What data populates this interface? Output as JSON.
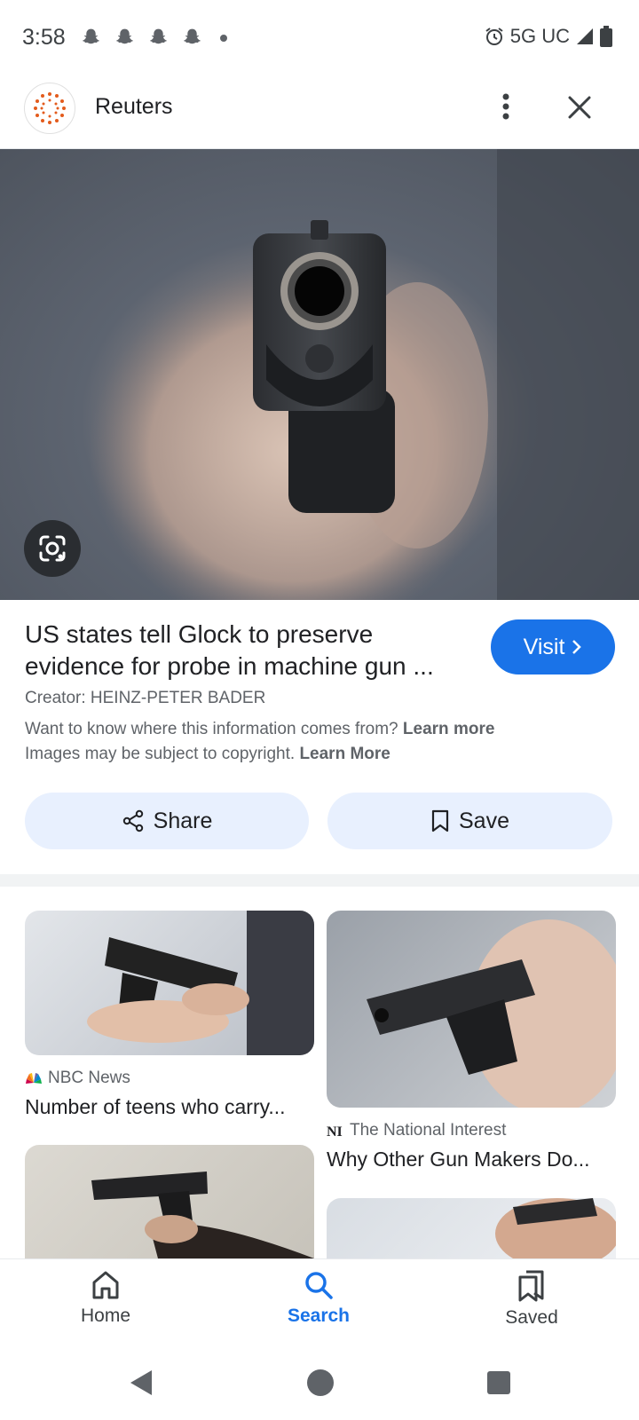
{
  "status_bar": {
    "time": "3:58",
    "notification_icons": [
      "snapchat-icon",
      "snapchat-icon",
      "snapchat-icon",
      "snapchat-icon",
      "more-dot"
    ],
    "network": "5G UC",
    "icons": [
      "alarm-icon",
      "signal-icon",
      "battery-icon"
    ]
  },
  "header": {
    "source_name": "Reuters",
    "more_icon": "more-vert-icon",
    "close_icon": "close-icon"
  },
  "image_detail": {
    "title": "US states tell Glock to preserve evidence for probe in machine gun ...",
    "visit_label": "Visit",
    "creator": "Creator: HEINZ-PETER BADER",
    "info_text": "Want to know where this information comes from?",
    "info_link": "Learn more",
    "copyright_text": "Images may be subject to copyright.",
    "copyright_link": "Learn More",
    "share_label": "Share",
    "save_label": "Save"
  },
  "related_results": [
    {
      "source": "NBC News",
      "title": "Number of teens who carry..."
    },
    {
      "source": "The National Interest",
      "title": "Why Other Gun Makers Do..."
    }
  ],
  "bottom_nav": {
    "items": [
      {
        "label": "Home",
        "icon": "home-icon"
      },
      {
        "label": "Search",
        "icon": "search-icon",
        "active": true
      },
      {
        "label": "Saved",
        "icon": "saved-icon"
      }
    ]
  },
  "colors": {
    "accent": "#1a73e8",
    "pill_bg": "#e8f0fe",
    "muted_text": "#5f6368"
  }
}
